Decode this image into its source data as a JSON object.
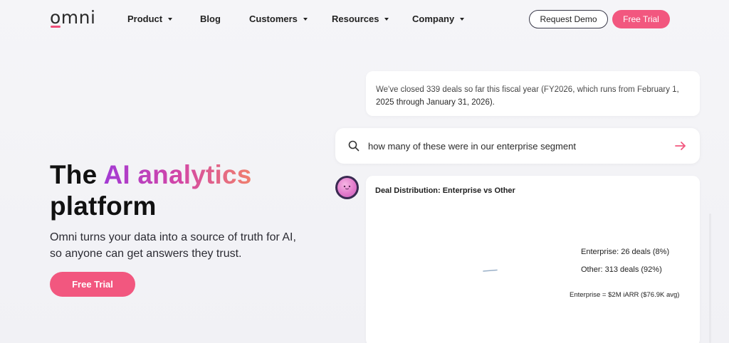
{
  "nav": {
    "logo": "omni",
    "items": [
      {
        "label": "Product",
        "dropdown": true
      },
      {
        "label": "Blog",
        "dropdown": false
      },
      {
        "label": "Customers",
        "dropdown": true
      },
      {
        "label": "Resources",
        "dropdown": true
      },
      {
        "label": "Company",
        "dropdown": true
      }
    ],
    "request_demo": "Request Demo",
    "free_trial": "Free Trial"
  },
  "hero": {
    "title_part1": "The ",
    "title_highlight": "AI analytics",
    "title_part2": "platform",
    "subtitle": "Omni turns your data into a source of truth for AI, so anyone can get answers they trust.",
    "cta": "Free Trial"
  },
  "chat": {
    "previous_answer": "We've closed 339 deals so far this fiscal year (FY2026, which runs from February 1, 2025 through January 31, 2026).",
    "query": "how many of these were in our enterprise segment",
    "result_title": "Deal Distribution: Enterprise vs Other",
    "legend": [
      "Enterprise: 26 deals (8%)",
      "Other: 313 deals (92%)"
    ],
    "note": "Enterprise = $2M iARR ($76.9K avg)"
  },
  "colors": {
    "accent": "#f2577f",
    "gradient_start": "#a33ad4",
    "gradient_end": "#f0806c"
  },
  "icons": {
    "search": "search-icon",
    "send": "arrow-right-icon",
    "avatar": "ai-avatar-icon",
    "caret": "chevron-down-icon"
  }
}
